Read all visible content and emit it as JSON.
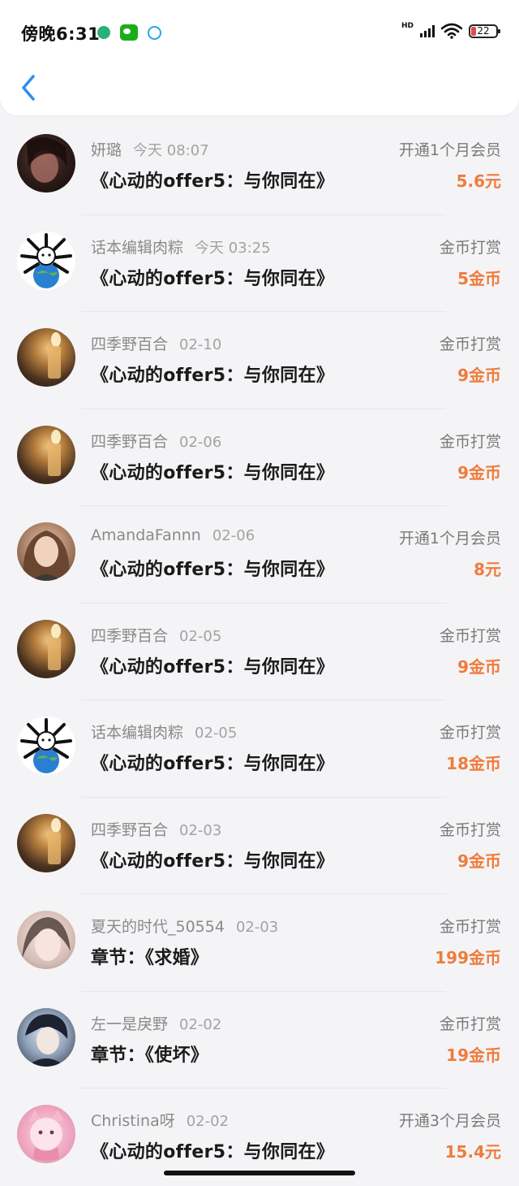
{
  "status_bar": {
    "time": "傍晚6:31",
    "hd": "HD",
    "battery": "22"
  },
  "colors": {
    "accent_blue": "#2f8ff0",
    "amount_orange": "#f07b3c",
    "meta_gray": "#8a8a8a"
  },
  "records": [
    {
      "name": "妍璐",
      "date": "今天 08:07",
      "title": "《心动的offer5：与你同在》",
      "type": "开通1个月会员",
      "amount": "5.6元"
    },
    {
      "name": "话本编辑肉粽",
      "date": "今天 03:25",
      "title": "《心动的offer5：与你同在》",
      "type": "金币打赏",
      "amount": "5金币"
    },
    {
      "name": "四季野百合",
      "date": "02-10",
      "title": "《心动的offer5：与你同在》",
      "type": "金币打赏",
      "amount": "9金币"
    },
    {
      "name": "四季野百合",
      "date": "02-06",
      "title": "《心动的offer5：与你同在》",
      "type": "金币打赏",
      "amount": "9金币"
    },
    {
      "name": "AmandaFannn",
      "date": "02-06",
      "title": "《心动的offer5：与你同在》",
      "type": "开通1个月会员",
      "amount": "8元"
    },
    {
      "name": "四季野百合",
      "date": "02-05",
      "title": "《心动的offer5：与你同在》",
      "type": "金币打赏",
      "amount": "9金币"
    },
    {
      "name": "话本编辑肉粽",
      "date": "02-05",
      "title": "《心动的offer5：与你同在》",
      "type": "金币打赏",
      "amount": "18金币"
    },
    {
      "name": "四季野百合",
      "date": "02-03",
      "title": "《心动的offer5：与你同在》",
      "type": "金币打赏",
      "amount": "9金币"
    },
    {
      "name": "夏天的时代_50554",
      "date": "02-03",
      "title": "章节：《求婚》",
      "type": "金币打赏",
      "amount": "199金币"
    },
    {
      "name": "左一是戾野",
      "date": "02-02",
      "title": "章节：《使坏》",
      "type": "金币打赏",
      "amount": "19金币"
    },
    {
      "name": "Christina呀",
      "date": "02-02",
      "title": "《心动的offer5：与你同在》",
      "type": "开通3个月会员",
      "amount": "15.4元"
    }
  ]
}
